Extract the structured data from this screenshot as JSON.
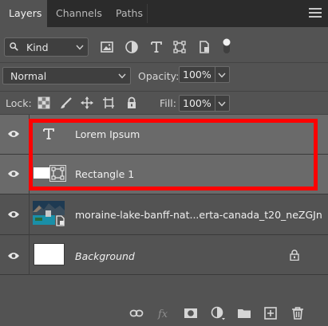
{
  "tabs": [
    {
      "label": "Layers",
      "active": true
    },
    {
      "label": "Channels",
      "active": false
    },
    {
      "label": "Paths",
      "active": false
    }
  ],
  "filter": {
    "kind_label": "Kind",
    "icons": [
      "image-filter-icon",
      "adjustment-filter-icon",
      "type-filter-icon",
      "shape-filter-icon",
      "smart-object-filter-icon",
      "filter-toggle-icon"
    ]
  },
  "blend": {
    "mode": "Normal",
    "opacity_label": "Opacity:",
    "opacity_value": "100%",
    "fill_label": "Fill:",
    "fill_value": "100%"
  },
  "lock": {
    "label": "Lock:",
    "icons": [
      "lock-transparent-pixels-icon",
      "lock-image-pixels-icon",
      "lock-position-icon",
      "lock-artboard-icon",
      "lock-all-icon"
    ]
  },
  "layers": [
    {
      "name": "Lorem Ipsum",
      "kind": "type",
      "selected": true,
      "visible": true,
      "italic": false
    },
    {
      "name": "Rectangle 1",
      "kind": "shape",
      "selected": true,
      "visible": true,
      "italic": false
    },
    {
      "name": "moraine-lake-banff-nat...erta-canada_t20_neZGJn",
      "kind": "smart-object",
      "selected": false,
      "visible": true,
      "italic": false
    },
    {
      "name": "Background",
      "kind": "background",
      "selected": false,
      "visible": true,
      "italic": true,
      "locked": true
    }
  ],
  "bottom_toolbar": [
    "link-layers-icon",
    "add-layer-style-icon",
    "add-mask-icon",
    "new-adjustment-layer-icon",
    "new-group-icon",
    "new-layer-icon",
    "delete-layer-icon"
  ],
  "colors": {
    "panel": "#535353",
    "tabbar": "#2b2b2b",
    "selected_row": "#6a6a6a",
    "highlight_outline": "#ff0000"
  }
}
